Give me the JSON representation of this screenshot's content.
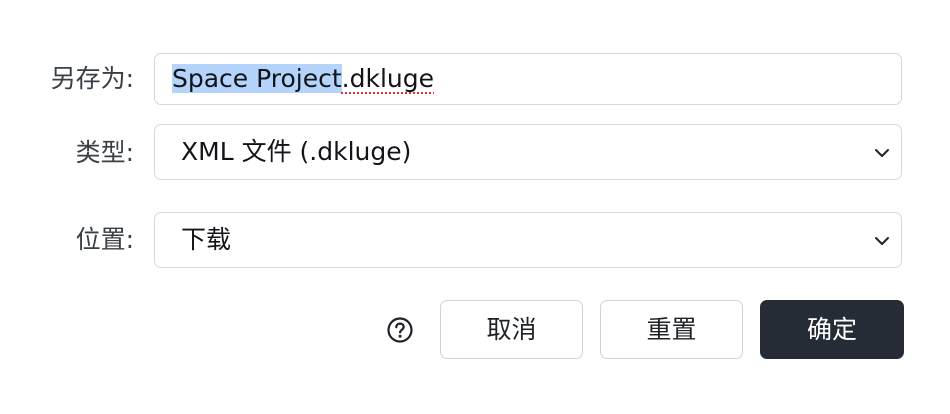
{
  "dialog": {
    "save_as": {
      "label": "另存为:",
      "value_selected": "Space Project",
      "value_rest": ".dkluge",
      "value_misspelled_part": ".dkluge"
    },
    "type": {
      "label": "类型:",
      "selected": "XML 文件 (.dkluge)"
    },
    "location": {
      "label": "位置:",
      "selected": "下载"
    },
    "buttons": {
      "help_icon": "help-circle-icon",
      "cancel_label": "取消",
      "reset_label": "重置",
      "confirm_label": "确定"
    },
    "colors": {
      "primary_button": "#252c36",
      "selection_highlight": "#b4d4fb",
      "spellcheck_underline": "#e0322b"
    }
  }
}
